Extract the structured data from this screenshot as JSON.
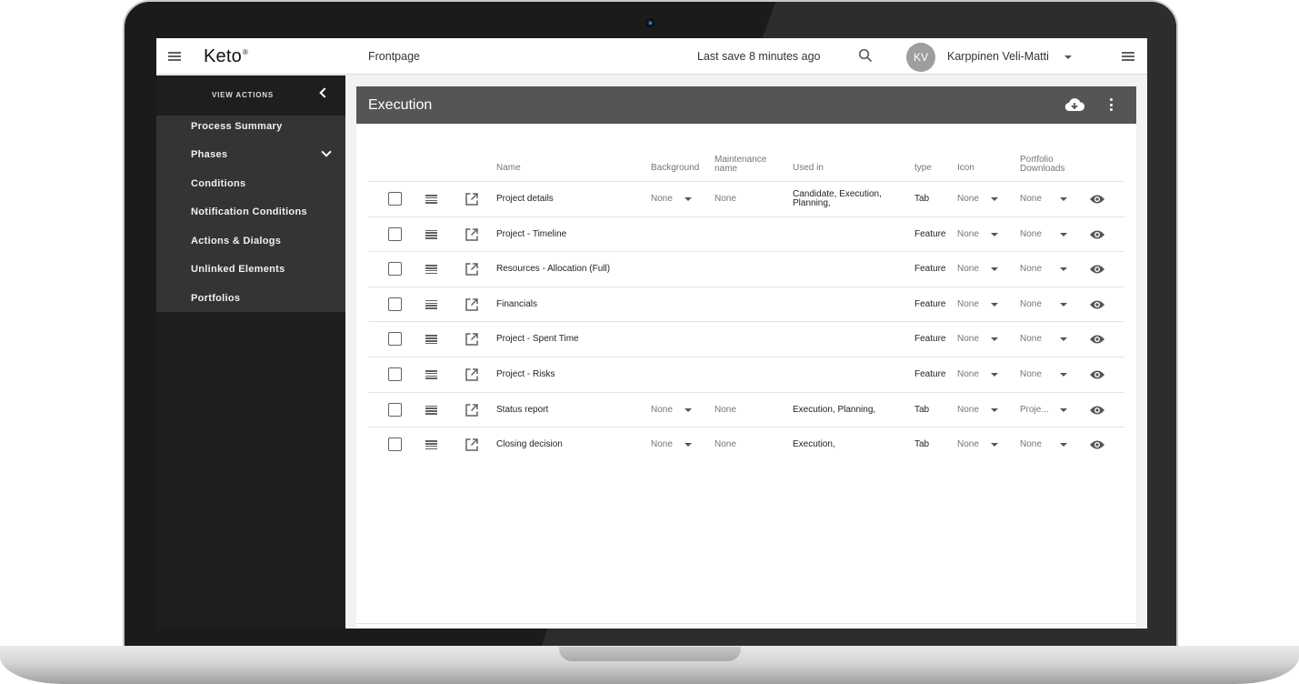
{
  "app": {
    "logo": "Keto",
    "logo_mark": "®",
    "breadcrumb": "Frontpage",
    "last_save": "Last save 8 minutes ago",
    "user_initials": "KV",
    "user_name": "Karppinen Veli-Matti"
  },
  "sidebar": {
    "title": "VIEW ACTIONS",
    "items": [
      {
        "label": "Process Summary"
      },
      {
        "label": "Phases"
      },
      {
        "label": "Conditions"
      },
      {
        "label": "Notification Conditions"
      },
      {
        "label": "Actions & Dialogs"
      },
      {
        "label": "Unlinked Elements"
      },
      {
        "label": "Portfolios"
      }
    ]
  },
  "main": {
    "title": "Execution",
    "columns": {
      "name": "Name",
      "background": "Background",
      "maintenance_1": "Maintenance",
      "maintenance_2": "name",
      "used_in": "Used in",
      "type": "type",
      "icon": "Icon",
      "portfolio_1": "Portfolio",
      "portfolio_2": "Downloads"
    },
    "rows": [
      {
        "name": "Project details",
        "background": "None",
        "maintenance": "None",
        "used_in_1": "Candidate, Execution,",
        "used_in_2": "Planning,",
        "type": "Tab",
        "icon": "None",
        "portfolio": "None"
      },
      {
        "name": "Project - Timeline",
        "background": "",
        "maintenance": "",
        "used_in_1": "",
        "used_in_2": "",
        "type": "Feature",
        "icon": "None",
        "portfolio": "None"
      },
      {
        "name": "Resources - Allocation (Full)",
        "background": "",
        "maintenance": "",
        "used_in_1": "",
        "used_in_2": "",
        "type": "Feature",
        "icon": "None",
        "portfolio": "None"
      },
      {
        "name": "Financials",
        "background": "",
        "maintenance": "",
        "used_in_1": "",
        "used_in_2": "",
        "type": "Feature",
        "icon": "None",
        "portfolio": "None"
      },
      {
        "name": "Project - Spent Time",
        "background": "",
        "maintenance": "",
        "used_in_1": "",
        "used_in_2": "",
        "type": "Feature",
        "icon": "None",
        "portfolio": "None"
      },
      {
        "name": "Project - Risks",
        "background": "",
        "maintenance": "",
        "used_in_1": "",
        "used_in_2": "",
        "type": "Feature",
        "icon": "None",
        "portfolio": "None"
      },
      {
        "name": "Status report",
        "background": "None",
        "maintenance": "None",
        "used_in_1": "Execution, Planning,",
        "used_in_2": "",
        "type": "Tab",
        "icon": "None",
        "portfolio": "Proje..."
      },
      {
        "name": "Closing decision",
        "background": "None",
        "maintenance": "None",
        "used_in_1": "Execution,",
        "used_in_2": "",
        "type": "Tab",
        "icon": "None",
        "portfolio": "None"
      }
    ]
  },
  "icons": {
    "menu": "hamburger-menu-icon",
    "search": "search-icon",
    "user_dropdown": "chevron-down-icon",
    "settings_menu": "hamburger-menu-icon",
    "back": "chevron-left-icon",
    "phases_expand": "chevron-down-icon",
    "download": "cloud-download-icon",
    "more": "kebab-menu-icon",
    "row_drag": "drag-handle-icon",
    "row_open": "open-external-icon",
    "row_visibility": "eye-icon"
  },
  "colors": {
    "sidebar_bg": "#343434",
    "sidebar_dark": "#1e1e1e",
    "header_bg": "#555555",
    "avatar": "#9e9e9e"
  }
}
